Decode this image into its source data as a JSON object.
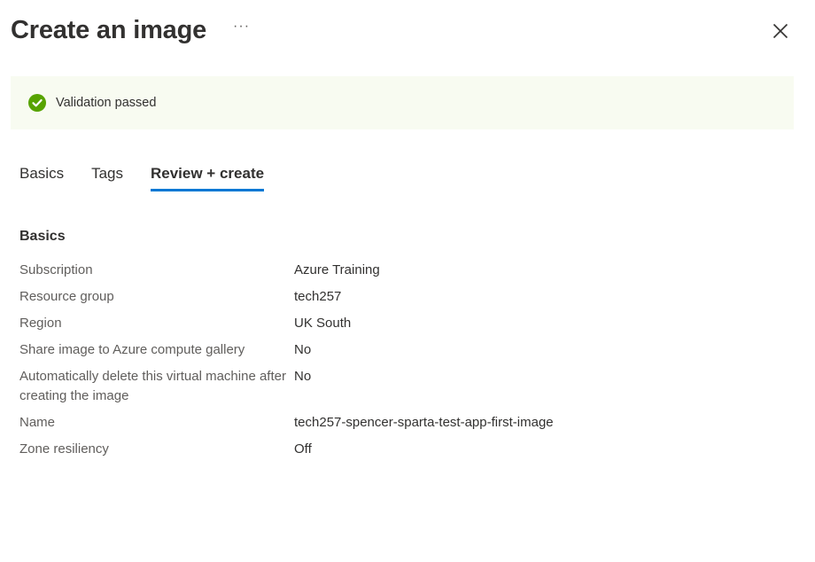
{
  "header": {
    "title": "Create an image",
    "more_label": "···",
    "close_icon": "close-icon"
  },
  "validation": {
    "message": "Validation passed",
    "icon": "check-circle-icon",
    "icon_color": "#57a300",
    "background": "#f8fbf1"
  },
  "tabs": [
    {
      "label": "Basics",
      "active": false
    },
    {
      "label": "Tags",
      "active": false
    },
    {
      "label": "Review + create",
      "active": true
    }
  ],
  "accent_color": "#0078d4",
  "basics": {
    "title": "Basics",
    "rows": [
      {
        "label": "Subscription",
        "value": "Azure Training"
      },
      {
        "label": "Resource group",
        "value": "tech257"
      },
      {
        "label": "Region",
        "value": "UK South"
      },
      {
        "label": "Share image to Azure compute gallery",
        "value": "No"
      },
      {
        "label": "Automatically delete this virtual machine after creating the image",
        "value": "No"
      },
      {
        "label": "Name",
        "value": "tech257-spencer-sparta-test-app-first-image"
      },
      {
        "label": "Zone resiliency",
        "value": "Off"
      }
    ]
  }
}
